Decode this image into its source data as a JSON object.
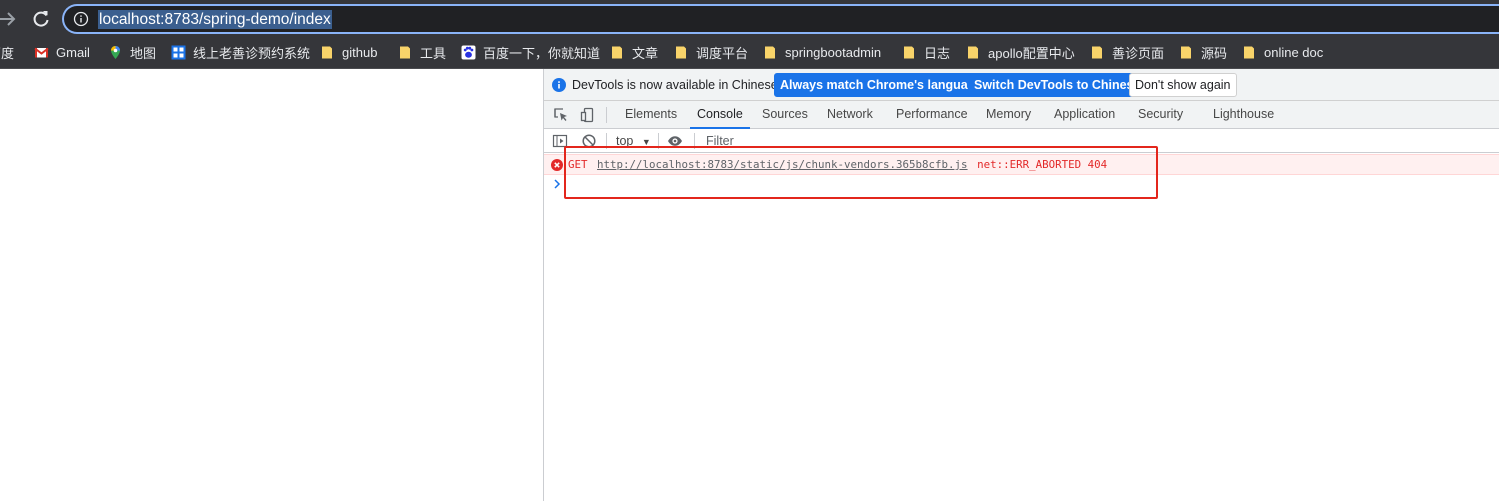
{
  "browser": {
    "url": "localhost:8783/spring-demo/index"
  },
  "bookmarks": [
    {
      "label": "百度",
      "icon": "baidu-icon"
    },
    {
      "label": "Gmail",
      "icon": "gmail-icon"
    },
    {
      "label": "地图",
      "icon": "maps-pin-icon"
    },
    {
      "label": "线上老善诊预约系统",
      "icon": "app-grid-icon"
    },
    {
      "label": "github",
      "icon": "folder-icon"
    },
    {
      "label": "工具",
      "icon": "folder-icon"
    },
    {
      "label": "百度一下，你就知道",
      "icon": "baidu-paw-icon"
    },
    {
      "label": "文章",
      "icon": "folder-icon"
    },
    {
      "label": "调度平台",
      "icon": "folder-icon"
    },
    {
      "label": "springbootadmin",
      "icon": "folder-icon"
    },
    {
      "label": "日志",
      "icon": "folder-icon"
    },
    {
      "label": "apollo配置中心",
      "icon": "folder-icon"
    },
    {
      "label": "善诊页面",
      "icon": "folder-icon"
    },
    {
      "label": "源码",
      "icon": "folder-icon"
    },
    {
      "label": "online doc",
      "icon": "folder-icon"
    }
  ],
  "devtools": {
    "infobar": {
      "message": "DevTools is now available in Chinese!",
      "match_language_label": "Always match Chrome's language",
      "switch_label": "Switch DevTools to Chinese",
      "dismiss_label": "Don't show again"
    },
    "tabs": [
      "Elements",
      "Console",
      "Sources",
      "Network",
      "Performance",
      "Memory",
      "Application",
      "Security",
      "Lighthouse"
    ],
    "active_tab": "Console",
    "console_toolbar": {
      "context": "top",
      "filter_placeholder": "Filter"
    },
    "messages": [
      {
        "level": "error",
        "method": "GET",
        "url": "http://localhost:8783/static/js/chunk-vendors.365b8cfb.js",
        "status": "net::ERR_ABORTED 404"
      }
    ]
  },
  "colors": {
    "chrome_bg": "#35363a",
    "omnibox_focus": "#8ab4f8",
    "primary_button": "#1a73e8",
    "error_text": "#e32929",
    "error_bg": "#fff0f0",
    "highlight_box": "#e3261c"
  }
}
